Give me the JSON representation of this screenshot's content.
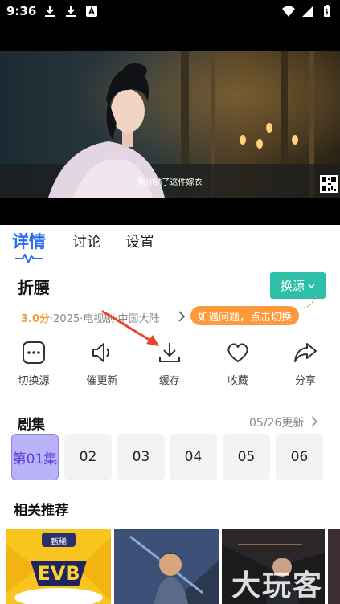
{
  "status_bar": {
    "time": "9:36",
    "left_icons": [
      "download-icon",
      "download-icon",
      "a-badge-icon"
    ],
    "right_icons": [
      "wifi-icon",
      "signal-icon",
      "battery-icon"
    ]
  },
  "video": {
    "subtitle": "帮你绣了这件嫁衣"
  },
  "tabs": [
    {
      "label": "详情",
      "active": true
    },
    {
      "label": "讨论",
      "active": false
    },
    {
      "label": "设置",
      "active": false
    }
  ],
  "show": {
    "title": "折腰",
    "switch_source_label": "换源",
    "score": "3.0分",
    "meta": "·2025·电视剧·中国大陆",
    "tooltip": "如遇问题，点击切换"
  },
  "actions": [
    {
      "label": "切换源",
      "icon": "switch-source-icon"
    },
    {
      "label": "催更新",
      "icon": "speaker-icon"
    },
    {
      "label": "缓存",
      "icon": "download-icon"
    },
    {
      "label": "收藏",
      "icon": "heart-icon"
    },
    {
      "label": "分享",
      "icon": "share-icon"
    }
  ],
  "episodes": {
    "title": "剧集",
    "update_text": "05/26更新",
    "items": [
      "第01集",
      "02",
      "03",
      "04",
      "05",
      "06"
    ],
    "current_index": 0
  },
  "recommendations": {
    "title": "相关推荐",
    "card1_badge": "甄稀"
  },
  "watermark": "大玩客",
  "colors": {
    "accent_blue": "#2b6ef5",
    "source_button": "#2dbfa7",
    "tooltip_orange": "#ff9a3c",
    "score_orange": "#f2a03c",
    "current_episode_bg": "#b9b2f6",
    "current_episode_text": "#5a3dde",
    "annotation_red": "#e8452f"
  }
}
